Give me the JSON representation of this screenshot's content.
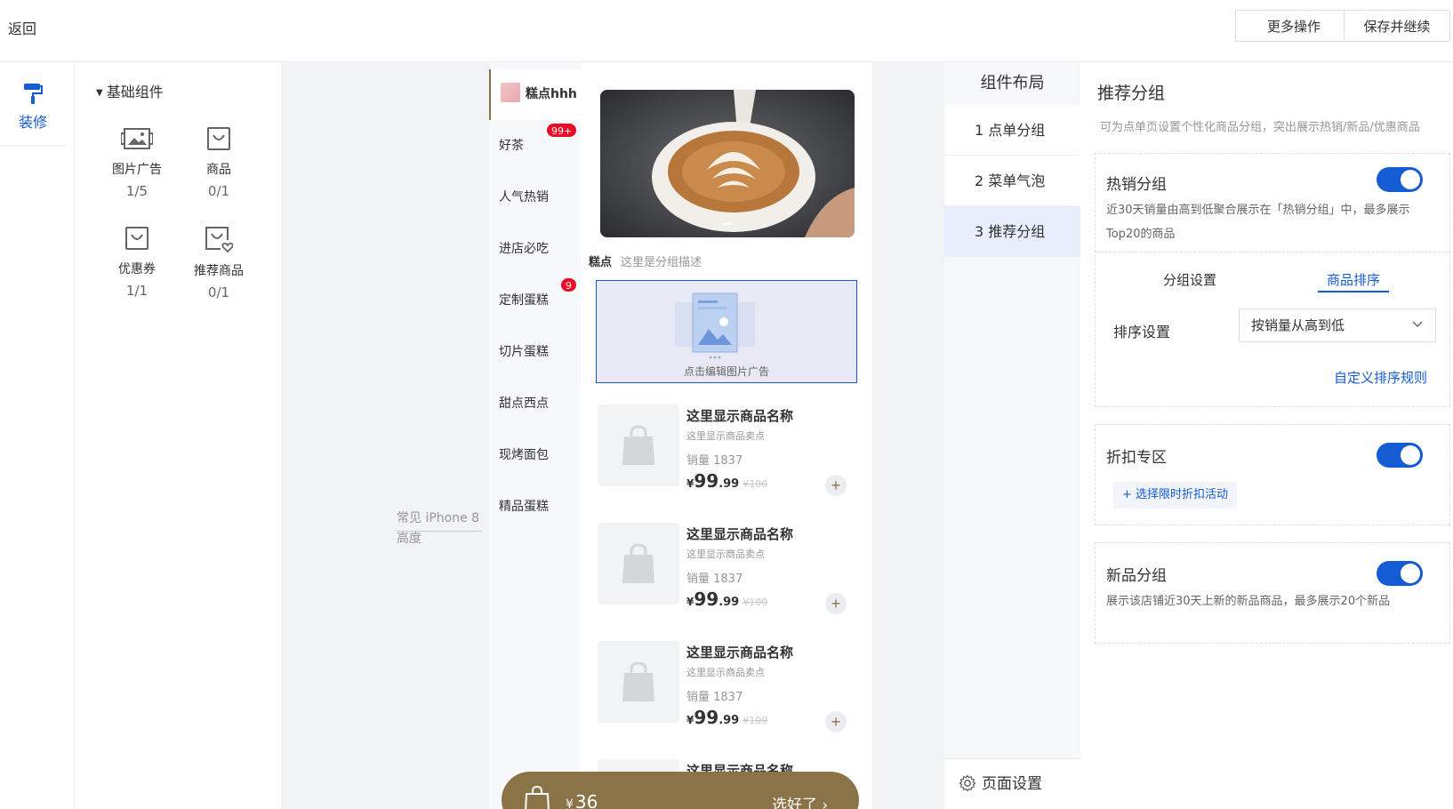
{
  "topbar": {
    "back": "返回",
    "more": "更多操作",
    "save": "保存并继续"
  },
  "rail": {
    "decorate": "装修"
  },
  "components": {
    "title": "基础组件",
    "items": [
      {
        "name": "图片广告",
        "count": "1/5",
        "icon": "image-ad-icon"
      },
      {
        "name": "商品",
        "count": "0/1",
        "icon": "goods-bag-icon"
      },
      {
        "name": "优惠券",
        "count": "1/1",
        "icon": "coupon-icon"
      },
      {
        "name": "推荐商品",
        "count": "0/1",
        "icon": "recommend-goods-icon"
      }
    ]
  },
  "canvas": {
    "iphone_note_1": "常见 iPhone 8",
    "iphone_note_2": "高度"
  },
  "phone": {
    "categories": [
      {
        "label": "糕点hhh",
        "active": true
      },
      {
        "label": "好茶",
        "badge": "99+"
      },
      {
        "label": "人气热销"
      },
      {
        "label": "进店必吃"
      },
      {
        "label": "定制蛋糕",
        "badge": "9"
      },
      {
        "label": "切片蛋糕"
      },
      {
        "label": "甜点西点"
      },
      {
        "label": "现烤面包"
      },
      {
        "label": "精品蛋糕"
      }
    ],
    "group_name": "糕点",
    "group_desc": "这里是分组描述",
    "ad_text": "点击编辑图片广告",
    "product": {
      "name": "这里显示商品名称",
      "selling_point": "这里显示商品卖点",
      "sales": "销量 1837",
      "currency": "¥",
      "price_int": "99",
      "price_dec": ".99",
      "price_old": "¥100",
      "add": "+"
    },
    "cart": {
      "currency": "¥",
      "amount": "36",
      "go": "选好了 ›"
    }
  },
  "layout": {
    "title": "组件布局",
    "items": [
      "1 点单分组",
      "2 菜单气泡",
      "3 推荐分组"
    ],
    "page_setting": "页面设置"
  },
  "settings": {
    "title": "推荐分组",
    "desc": "可为点单页设置个性化商品分组，突出展示热销/新品/优惠商品",
    "hot": {
      "title": "热销分组",
      "desc": "近30天销量由高到低聚合展示在「热销分组」中，最多展示Top20的商品",
      "tab1": "分组设置",
      "tab2": "商品排序",
      "sort_label": "排序设置",
      "sort_value": "按销量从高到低",
      "custom": "自定义排序规则"
    },
    "discount": {
      "title": "折扣专区",
      "choose": "+ 选择限时折扣活动"
    },
    "newgoods": {
      "title": "新品分组",
      "desc": "展示该店铺近30天上新的新品商品，最多展示20个新品"
    }
  },
  "colors": {
    "brand": "#155bd4",
    "accent": "#8a7347",
    "badge": "#ee0a24"
  }
}
